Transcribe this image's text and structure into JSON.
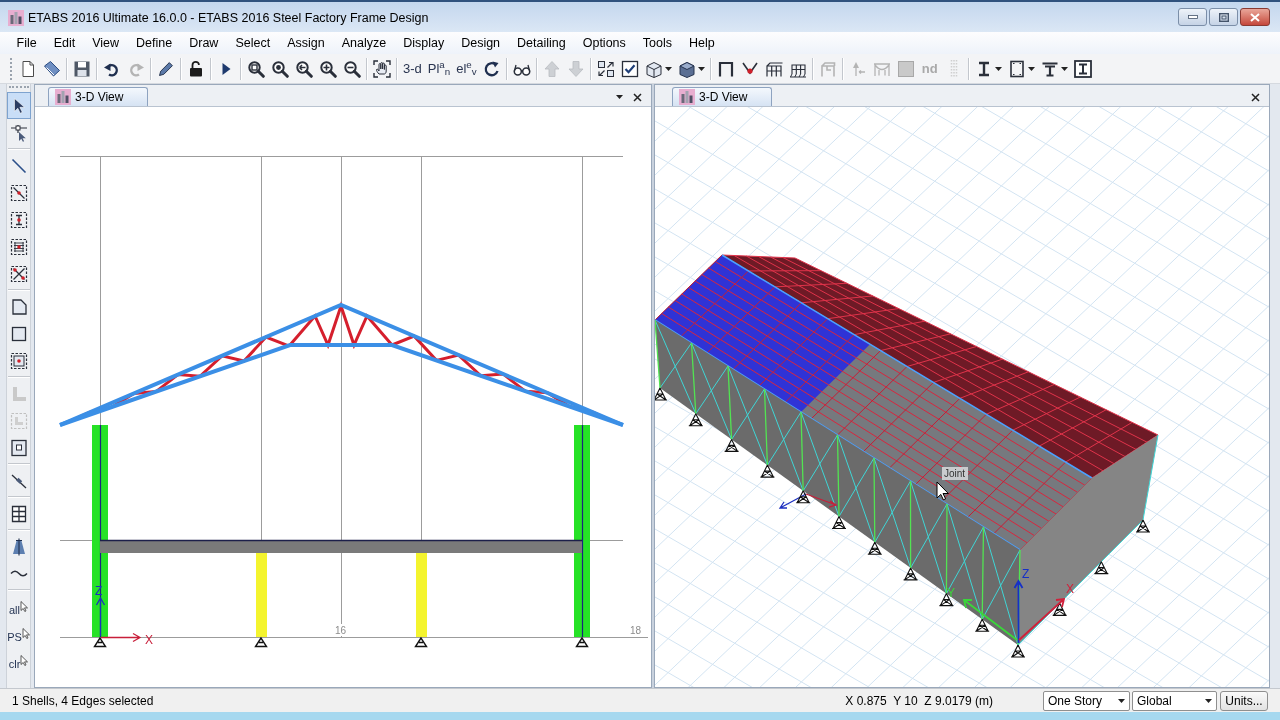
{
  "window": {
    "title": "ETABS 2016 Ultimate 16.0.0 - ETABS 2016 Steel Factory Frame Design"
  },
  "menu": [
    "File",
    "Edit",
    "View",
    "Define",
    "Draw",
    "Select",
    "Assign",
    "Analyze",
    "Display",
    "Design",
    "Detailing",
    "Options",
    "Tools",
    "Help"
  ],
  "toolbar": {
    "groups": [
      [
        {
          "kind": "icon",
          "disabled": false
        },
        {
          "kind": "icon",
          "disabled": false
        }
      ],
      [
        {
          "kind": "icon",
          "disabled": false
        }
      ],
      [
        {
          "kind": "icon",
          "disabled": false
        },
        {
          "kind": "icon",
          "disabled": true
        }
      ],
      [
        {
          "kind": "icon",
          "disabled": false
        }
      ],
      [
        {
          "kind": "icon",
          "disabled": false
        }
      ],
      [
        {
          "kind": "icon",
          "disabled": false
        }
      ],
      [
        {
          "kind": "icon",
          "disabled": false
        },
        {
          "kind": "icon",
          "disabled": false
        },
        {
          "kind": "icon",
          "disabled": false
        },
        {
          "kind": "icon",
          "disabled": false
        },
        {
          "kind": "icon",
          "disabled": false
        }
      ],
      [
        {
          "kind": "icon",
          "disabled": false
        }
      ],
      [
        {
          "kind": "text",
          "label": "3-d",
          "disabled": false
        },
        {
          "kind": "text",
          "label": "Pl$^{a}$$_{n}$",
          "disabled": false
        },
        {
          "kind": "text",
          "label": "el$^{e}$$_{v}$",
          "disabled": false
        },
        {
          "kind": "icon",
          "disabled": false
        }
      ],
      [
        {
          "kind": "icon",
          "disabled": false
        }
      ],
      [
        {
          "kind": "icon",
          "disabled": true
        },
        {
          "kind": "icon",
          "disabled": true
        }
      ],
      [
        {
          "kind": "icon",
          "disabled": false
        },
        {
          "kind": "icon",
          "disabled": false
        },
        {
          "kind": "icon",
          "disabled": false,
          "menu": true
        },
        {
          "kind": "icon",
          "disabled": false,
          "menu": true
        }
      ],
      [
        {
          "kind": "icon",
          "disabled": false
        },
        {
          "kind": "icon",
          "disabled": false
        },
        {
          "kind": "icon",
          "disabled": false
        },
        {
          "kind": "icon",
          "disabled": false
        }
      ],
      [
        {
          "kind": "icon",
          "disabled": true
        }
      ],
      [
        {
          "kind": "icon",
          "disabled": true
        },
        {
          "kind": "icon",
          "disabled": true
        },
        {
          "kind": "icon",
          "disabled": true
        },
        {
          "kind": "text",
          "label": "nd",
          "disabled": true
        },
        {
          "kind": "icon",
          "disabled": true
        }
      ],
      [
        {
          "kind": "icon",
          "disabled": false,
          "menu": true
        },
        {
          "kind": "icon",
          "disabled": false,
          "menu": true
        },
        {
          "kind": "icon",
          "disabled": false,
          "menu": true
        },
        {
          "kind": "icon",
          "disabled": false
        }
      ]
    ]
  },
  "tools": {
    "groups": [
      [
        {
          "kind": "icon",
          "selected": true,
          "disabled": false
        },
        {
          "kind": "icon",
          "selected": false,
          "disabled": false
        }
      ],
      [
        {
          "kind": "icon",
          "selected": false,
          "disabled": false
        },
        {
          "kind": "icon",
          "selected": false,
          "disabled": false
        },
        {
          "kind": "icon",
          "selected": false,
          "disabled": false
        },
        {
          "kind": "icon",
          "selected": false,
          "disabled": false
        },
        {
          "kind": "icon",
          "selected": false,
          "disabled": false
        }
      ],
      [
        {
          "kind": "icon",
          "selected": false,
          "disabled": false
        },
        {
          "kind": "icon",
          "selected": false,
          "disabled": false
        },
        {
          "kind": "icon",
          "selected": false,
          "disabled": false
        }
      ],
      [
        {
          "kind": "icon",
          "selected": false,
          "disabled": true
        },
        {
          "kind": "icon",
          "selected": false,
          "disabled": true
        },
        {
          "kind": "icon",
          "selected": false,
          "disabled": false
        }
      ],
      [
        {
          "kind": "icon",
          "selected": false,
          "disabled": false
        }
      ],
      [
        {
          "kind": "icon",
          "selected": false,
          "disabled": false
        }
      ],
      [
        {
          "kind": "icon",
          "selected": false,
          "disabled": false
        },
        {
          "kind": "icon",
          "selected": false,
          "disabled": false
        }
      ],
      [
        {
          "kind": "text",
          "label": "all",
          "selected": false,
          "disabled": false
        },
        {
          "kind": "text",
          "label": "PS",
          "selected": false,
          "disabled": false
        },
        {
          "kind": "text",
          "label": "clr",
          "selected": false,
          "disabled": false
        }
      ]
    ]
  },
  "left_view": {
    "tab": "3-D View",
    "axes": {
      "z": "Z",
      "x": "X"
    },
    "grid_labels": [
      "16",
      "18"
    ]
  },
  "right_view": {
    "tab": "3-D View",
    "hover_label": "Joint",
    "axes": {
      "z": "Z",
      "x": "X",
      "y": "Y"
    }
  },
  "status_bar": {
    "selection": "1 Shells, 4 Edges selected",
    "coordinates": "X 0.875  Y 10  Z 9.0179 (m)",
    "story": "One Story",
    "coord_system": "Global",
    "units_button": "Units..."
  }
}
